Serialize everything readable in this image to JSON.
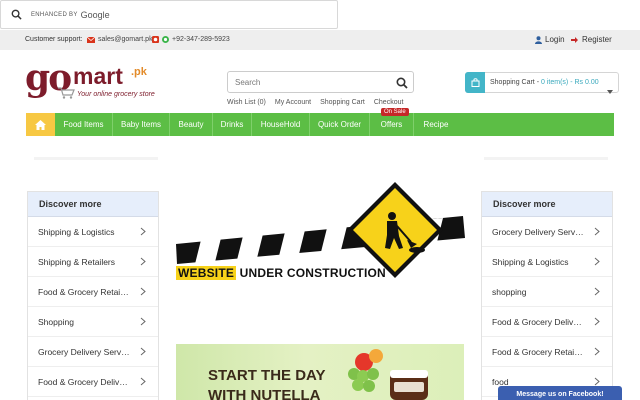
{
  "google_search": {
    "enhanced_label": "ENHANCED BY",
    "google_word": "Google"
  },
  "topbar": {
    "support_label": "Customer support:",
    "email": "sales@gomart.pk",
    "phone": "+92-347-289-5923",
    "login": "Login",
    "register": "Register"
  },
  "logo": {
    "go": "go",
    "mart": "mart",
    "pk": ".pk",
    "tagline": "Your online grocery store"
  },
  "search": {
    "placeholder": "Search"
  },
  "quick_links": [
    "Wish List (0)",
    "My Account",
    "Shopping Cart",
    "Checkout"
  ],
  "cart": {
    "label": "Shopping Cart -",
    "value": "0 item(s) - Rs 0.00"
  },
  "nav": {
    "items": [
      "Food Items",
      "Baby Items",
      "Beauty",
      "Drinks",
      "HouseHold",
      "Quick Order",
      "Offers",
      "Recipe"
    ],
    "offers_badge": "On Sale"
  },
  "left_panel": {
    "title": "Discover more",
    "items": [
      "Shipping & Logistics",
      "Shipping & Retailers",
      "Food & Grocery Retailers",
      "Shopping",
      "Grocery Delivery Services",
      "Food & Grocery Delivery"
    ]
  },
  "right_panel": {
    "title": "Discover more",
    "items": [
      "Grocery Delivery Services",
      "Shipping & Logistics",
      "shopping",
      "Food & Grocery Delivery",
      "Food & Grocery Retailers",
      "food"
    ]
  },
  "construction": {
    "word1": "WEBSITE",
    "word2": "UNDER CONSTRUCTION"
  },
  "promo": {
    "line1": "START THE DAY",
    "line2": "WITH NUTELLA"
  },
  "facebook_button": "Message us on Facebook!",
  "colors": {
    "nav_green": "#5cbe45",
    "home_yellow": "#f7c843",
    "brand_maroon": "#7d1c2b",
    "cart_teal": "#43b5c8",
    "fb_blue": "#3b5fb0"
  }
}
